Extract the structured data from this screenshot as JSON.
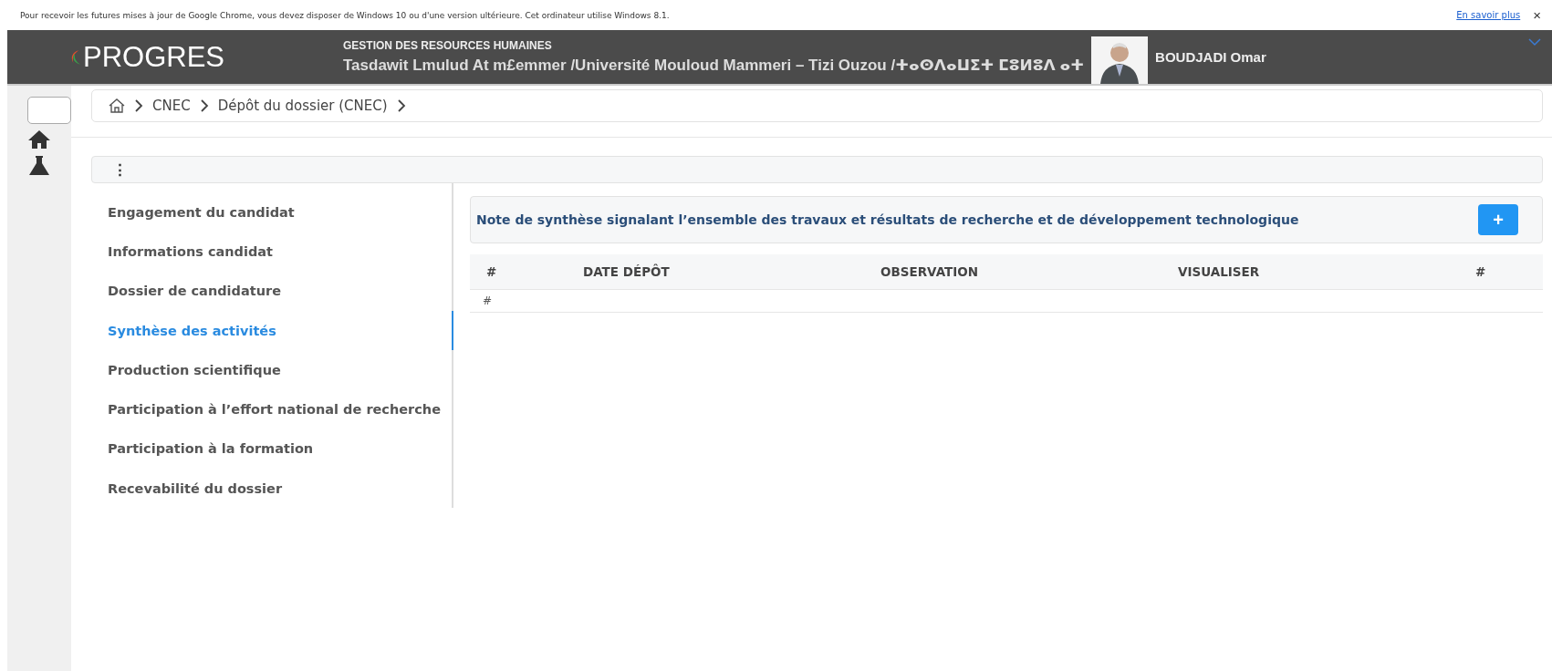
{
  "notice": {
    "text": "Pour recevoir les futures mises à jour de Google Chrome, vous devez disposer de Windows 10 ou d'une version ultérieure. Cet ordinateur utilise Windows 8.1.",
    "link": "En savoir plus",
    "close": "×"
  },
  "header": {
    "logo": "PROGRES",
    "subtitle": "GESTION DES RESOURCES HUMAINES",
    "title": "Tasdawit Lmulud At m£emmer /Université Mouloud Mammeri – Tizi Ouzou /ⵜⴰⵙⴷⴰⵡⵉⵜ ⵎⵓⵍⵓⴷ ⴰⵜ",
    "user": "BOUDJADI Omar"
  },
  "breadcrumb": [
    "CNEC",
    "Dépôt du dossier (CNEC)"
  ],
  "toolbar": {
    "menu": "⋮"
  },
  "nav": [
    {
      "label": "Engagement du candidat",
      "selected": false
    },
    {
      "label": "Informations candidat",
      "selected": false
    },
    {
      "label": "Dossier de candidature",
      "selected": false
    },
    {
      "label": "Synthèse des activités",
      "selected": true
    },
    {
      "label": "Production scientifique",
      "selected": false
    },
    {
      "label": "Participation à l’effort national de recherche",
      "selected": false
    },
    {
      "label": "Participation à la formation",
      "selected": false
    },
    {
      "label": "Recevabilité du dossier",
      "selected": false
    }
  ],
  "card": {
    "title": "Note de synthèse signalant l’ensemble des travaux et résultats de recherche et de développement technologique",
    "add": "+"
  },
  "table": {
    "columns": [
      "#",
      "DATE DÉPÔT",
      "OBSERVATION",
      "VISUALISER",
      "#"
    ],
    "rows": [
      [
        "#"
      ]
    ]
  }
}
